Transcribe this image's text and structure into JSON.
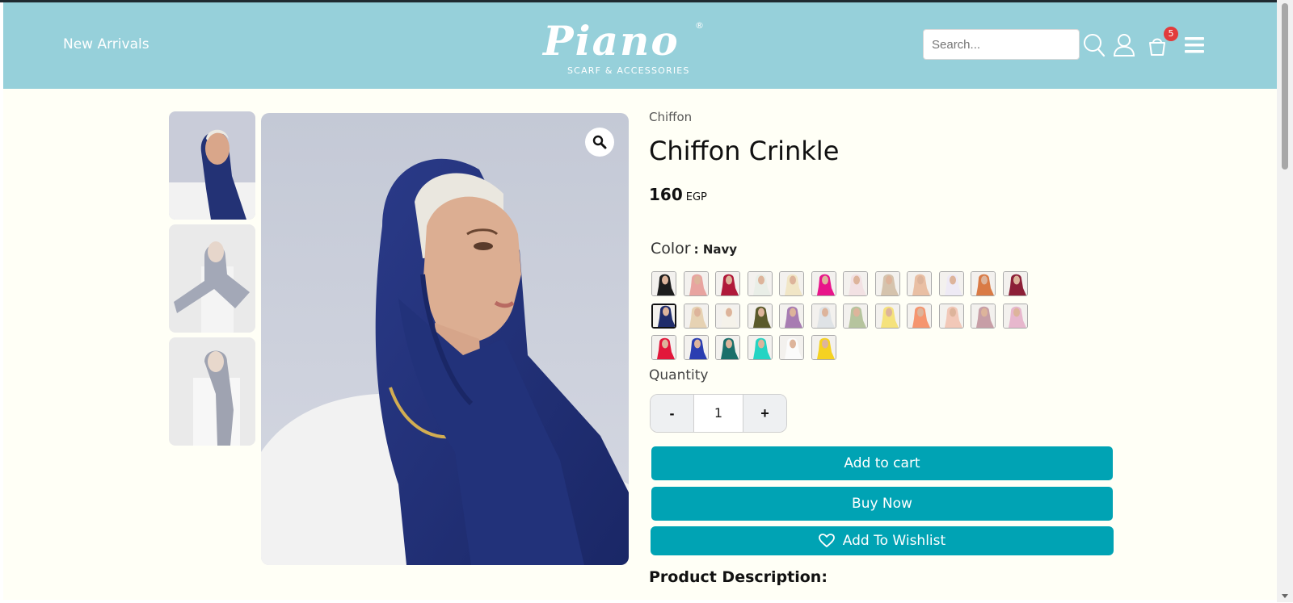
{
  "header": {
    "new_arrivals": "New Arrivals",
    "logo_text": "Piano",
    "logo_reg": "®",
    "logo_sub": "SCARF & ACCESSORIES",
    "search_placeholder": "Search...",
    "cart_count": "5",
    "icons": [
      "search-icon",
      "user-icon",
      "cart-icon",
      "menu-icon"
    ],
    "bg_color": "#96d0da"
  },
  "gallery": {
    "thumbnails": [
      "thumbnail-1",
      "thumbnail-2",
      "thumbnail-3"
    ],
    "zoom_icon": "magnifier-icon"
  },
  "product": {
    "category": "Chiffon",
    "title": "Chiffon Crinkle",
    "price": "160",
    "currency": "EGP",
    "color_label": "Color",
    "color_value": ": Navy",
    "swatch_colors": [
      "#1d1d1d",
      "#e8a4a0",
      "#b0193a",
      "#e9eee7",
      "#f1e6c6",
      "#e8158a",
      "#f2e1e3",
      "#d5c3ad",
      "#e9bfa4",
      "#eeeaf5",
      "#d97a45",
      "#8c1f37",
      "#1f2c6b",
      "#e6d2b3",
      "#f5f2ea",
      "#5a5a2b",
      "#a77cb2",
      "#dfe3e6",
      "#b6c49e",
      "#f5e27c",
      "#f5956f",
      "#f2c8b8",
      "#c79ea6",
      "#e7b7cd",
      "#e2173a",
      "#2a3eb1",
      "#1a6f6a",
      "#25d4c3",
      "#fbfbfb",
      "#f5d221"
    ],
    "selected_swatch": 12,
    "quantity_label": "Quantity",
    "quantity": "1",
    "minus": "-",
    "plus": "+",
    "add_to_cart": "Add to cart",
    "buy_now": "Buy Now",
    "add_to_wishlist": "Add To Wishlist",
    "description_heading": "Product Description:",
    "accent_color": "#00a3b4"
  }
}
